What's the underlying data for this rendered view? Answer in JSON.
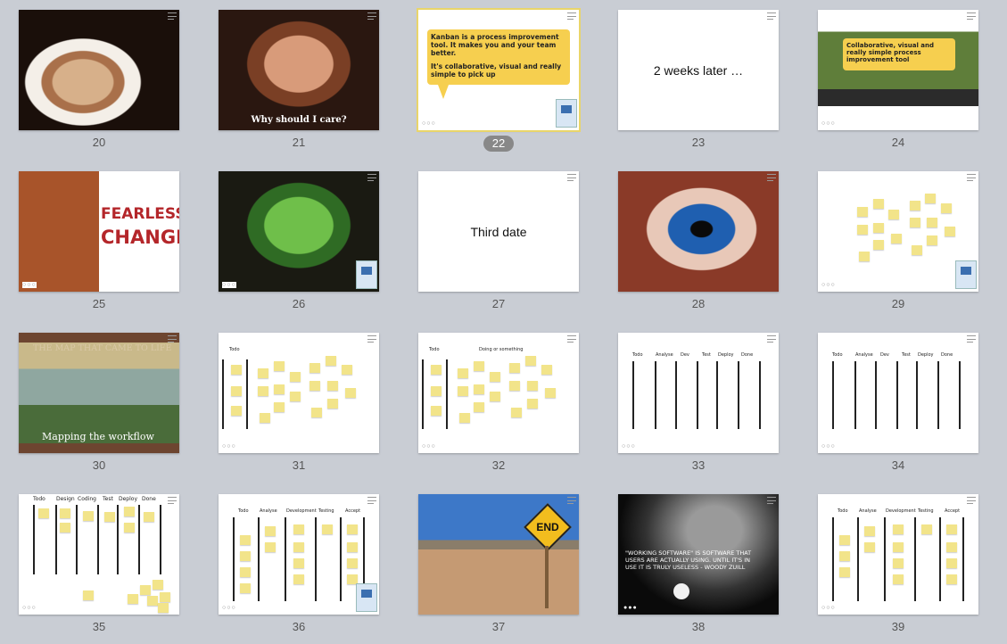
{
  "slides": [
    {
      "num": "20"
    },
    {
      "num": "21",
      "caption": "Why should I care?"
    },
    {
      "num": "22",
      "text1": "Kanban is a process improvement tool. It makes you and your team better.",
      "text2": "It's collaborative, visual and really simple to pick up"
    },
    {
      "num": "23",
      "title": "2 weeks later …"
    },
    {
      "num": "24",
      "text": "Collaborative, visual and really simple process improvement tool"
    },
    {
      "num": "25",
      "book_title1": "FEARLESS",
      "book_title2": "CHANGE"
    },
    {
      "num": "26"
    },
    {
      "num": "27",
      "title": "Third date"
    },
    {
      "num": "28"
    },
    {
      "num": "29"
    },
    {
      "num": "30",
      "heading": "THE MAP THAT CAME TO LIFE",
      "caption": "Mapping the workflow"
    },
    {
      "num": "31",
      "header": "Todo"
    },
    {
      "num": "32",
      "header1": "Todo",
      "header2": "Doing or something"
    },
    {
      "num": "33",
      "cols": [
        "Todo",
        "Analyse",
        "Dev",
        "Test",
        "Deploy",
        "Done"
      ]
    },
    {
      "num": "34",
      "cols": [
        "Todo",
        "Analyse",
        "Dev",
        "Test",
        "Deploy",
        "Done"
      ]
    },
    {
      "num": "35",
      "cols": [
        "Todo",
        "Design",
        "Coding",
        "Test",
        "Deploy",
        "Done"
      ]
    },
    {
      "num": "36",
      "cols": [
        "Todo",
        "Analyse",
        "Development",
        "Testing",
        "Accept"
      ]
    },
    {
      "num": "37",
      "sign": "END"
    },
    {
      "num": "38",
      "quote": "\"WORKING SOFTWARE\" IS SOFTWARE THAT USERS ARE ACTUALLY USING. UNTIL IT'S IN USE IT IS TRULY USELESS - WOODY ZUILL"
    },
    {
      "num": "39",
      "cols": [
        "Todo",
        "Analyse",
        "Development",
        "Testing",
        "Accept"
      ]
    }
  ],
  "selected_index": 2
}
